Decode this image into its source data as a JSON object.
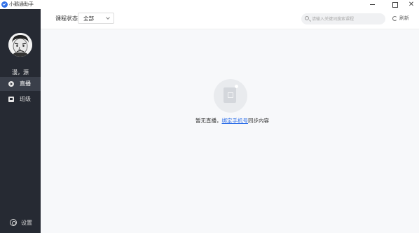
{
  "window": {
    "title": "小鹅通助手",
    "close_glyph": "✕"
  },
  "sidebar": {
    "user_name": "漫，源",
    "items": [
      {
        "label": "直播",
        "icon": "play-circle-icon",
        "active": true
      },
      {
        "label": "班级",
        "icon": "class-board-icon",
        "active": false
      }
    ],
    "settings_label": "设置"
  },
  "toolbar": {
    "filter_label": "课程状态:",
    "filter_value": "全部",
    "search_placeholder": "请输入关键词搜索课程",
    "refresh_label": "刷新"
  },
  "empty_state": {
    "prefix": "暂无直播，",
    "link_text": "绑定手机号",
    "suffix": "同步内容"
  },
  "colors": {
    "sidebar_bg": "#262a33",
    "accent": "#2f6fe8",
    "content_bg": "#f7f8fa"
  }
}
